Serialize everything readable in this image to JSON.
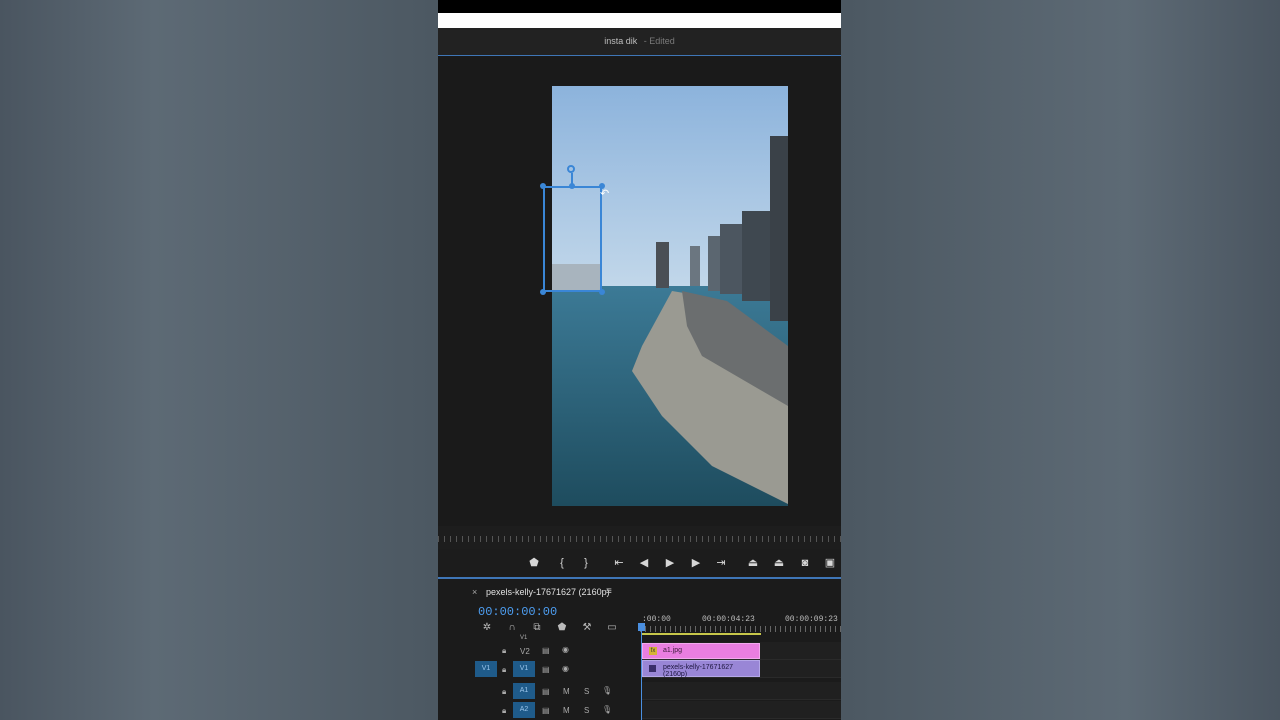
{
  "window": {
    "title": "insta dik",
    "status": "- Edited"
  },
  "sequence": {
    "name": "pexels-kelly-17671627 (2160p)",
    "close_glyph": "×",
    "menu_glyph": "≡"
  },
  "timecode": "00:00:00:00",
  "ruler_labels": [
    ":00:00",
    "00:00:04:23",
    "00:00:09:23"
  ],
  "tracks": {
    "v1_label": "V1",
    "v2_label": "V2",
    "v1_source": "V1",
    "v1_target": "V1",
    "a1_label": "A1",
    "a2_label": "A2",
    "mute": "M",
    "solo": "S"
  },
  "clips": {
    "overlay": "a1.jpg",
    "video": "pexels-kelly-17671627 (2160p)"
  },
  "colors": {
    "accent": "#3f76b7",
    "timecode": "#4d9df0",
    "overlay_clip": "#e97ee0",
    "video_clip": "#9986d6"
  }
}
